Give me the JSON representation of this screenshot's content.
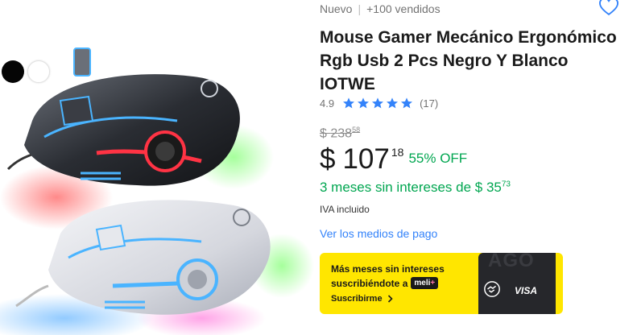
{
  "product": {
    "condition": "Nuevo",
    "separator": "|",
    "sold": "+100 vendidos",
    "title": "Mouse Gamer Mecánico Ergonómico Rgb Usb 2 Pcs Negro Y Blanco IOTWE",
    "rating": {
      "score": "4.9",
      "stars": 5,
      "count": "(17)"
    },
    "original_price": {
      "currency": "$",
      "amount": "238",
      "cents": "58"
    },
    "price": {
      "currency": "$",
      "amount": "107",
      "cents": "18",
      "discount": "55% OFF"
    },
    "installments": {
      "text": "3 meses sin intereses de $ 35",
      "cents": "73"
    },
    "tax_note": "IVA incluido",
    "payment_link": "Ver los medios de pago"
  },
  "variants": [
    {
      "name": "black",
      "color": "#050505"
    },
    {
      "name": "white",
      "color": "#ffffff"
    }
  ],
  "promo": {
    "line1": "Más meses sin intereses",
    "line2": "suscribiéndote a",
    "badge_text": "meli",
    "badge_plus": "+",
    "cta": "Suscribirme",
    "card_brand": "VISA",
    "card_ghost_text": "AGO",
    "background": "#ffe600"
  },
  "colors": {
    "accent_green": "#00a650",
    "link_blue": "#3483fa",
    "star_blue": "#3483fa",
    "heart_blue": "#3483fa"
  },
  "icons": {
    "heart": "heart-outline-icon",
    "star": "star-icon",
    "chevron": "chevron-right-icon",
    "handshake": "handshake-icon"
  }
}
